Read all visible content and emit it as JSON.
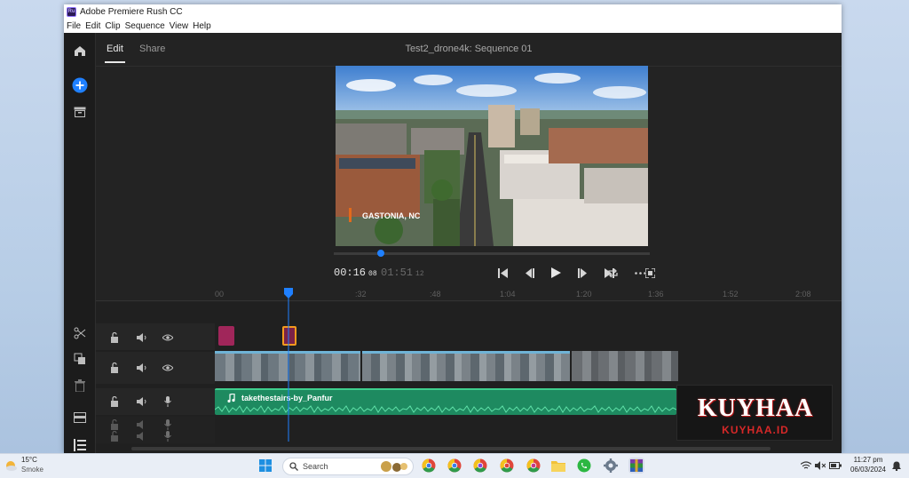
{
  "window": {
    "title": "Adobe Premiere Rush CC",
    "app_icon_label": "Ru",
    "menu": [
      "File",
      "Edit",
      "Clip",
      "Sequence",
      "View",
      "Help"
    ]
  },
  "header": {
    "tabs": [
      {
        "label": "Edit",
        "active": true
      },
      {
        "label": "Share",
        "active": false
      }
    ],
    "sequence_title": "Test2_drone4k: Sequence 01"
  },
  "preview": {
    "overlay_text": "GASTONIA, NC"
  },
  "transport": {
    "current_time": "00:16",
    "current_frames": "08",
    "duration": "01:51",
    "duration_frames": "12",
    "playhead_progress": 0.15
  },
  "ruler": {
    "labels": [
      ":00",
      ":32",
      ":48",
      "1:04",
      "1:20",
      "1:36",
      "1:52",
      "2:08"
    ],
    "first_label": "00"
  },
  "audio_track": {
    "clip_name": "takethestairs-by_Panfur"
  },
  "watermark": {
    "big": "KUYHAA",
    "small": "KUYHAA.ID"
  },
  "taskbar": {
    "weather_temp": "15°C",
    "weather_desc": "Smoke",
    "search_placeholder": "Search",
    "time": "11:27 pm",
    "date": "06/03/2024"
  },
  "colors": {
    "accent_blue": "#1f80ff",
    "playhead_orange": "#f39a1e",
    "audio_green": "#1e8a60",
    "title_pink": "#a0265a"
  }
}
